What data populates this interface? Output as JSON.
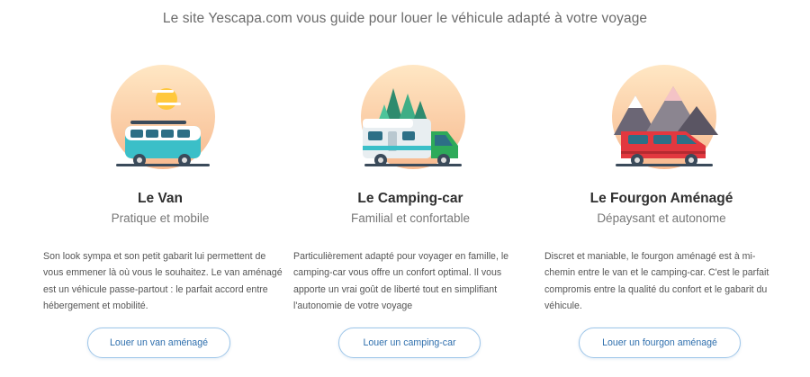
{
  "intro": "Le site Yescapa.com vous guide pour louer le véhicule adapté à votre voyage",
  "cards": [
    {
      "icon": "van-illustration",
      "title": "Le Van",
      "subtitle": "Pratique et mobile",
      "description": "Son look sympa et son petit gabarit lui permettent de vous emmener là où vous le souhaitez. Le van aménagé est un véhicule passe-partout : le parfait accord entre hébergement et mobilité.",
      "button": "Louer un van aménagé"
    },
    {
      "icon": "camping-car-illustration",
      "title": "Le Camping-car",
      "subtitle": "Familial et confortable",
      "description": "Particulièrement adapté pour voyager en famille, le camping-car vous offre un confort optimal. Il vous apporte un vrai goût de liberté tout en simplifiant l'autonomie de votre voyage",
      "button": "Louer un camping-car"
    },
    {
      "icon": "fourgon-illustration",
      "title": "Le Fourgon Aménagé",
      "subtitle": "Dépaysant et autonome",
      "description": "Discret et maniable, le fourgon aménagé est à mi-chemin entre le van et le camping-car. C'est le parfait compromis entre la qualité du confort et le gabarit du véhicule.",
      "button": "Louer un fourgon aménagé"
    }
  ],
  "colors": {
    "button_border": "#9ec6e9",
    "button_text": "#2f6fad",
    "sun_gradient_top": "#ffd9a8",
    "van_teal": "#3bbfc8",
    "fourgon_red": "#e2383f"
  }
}
